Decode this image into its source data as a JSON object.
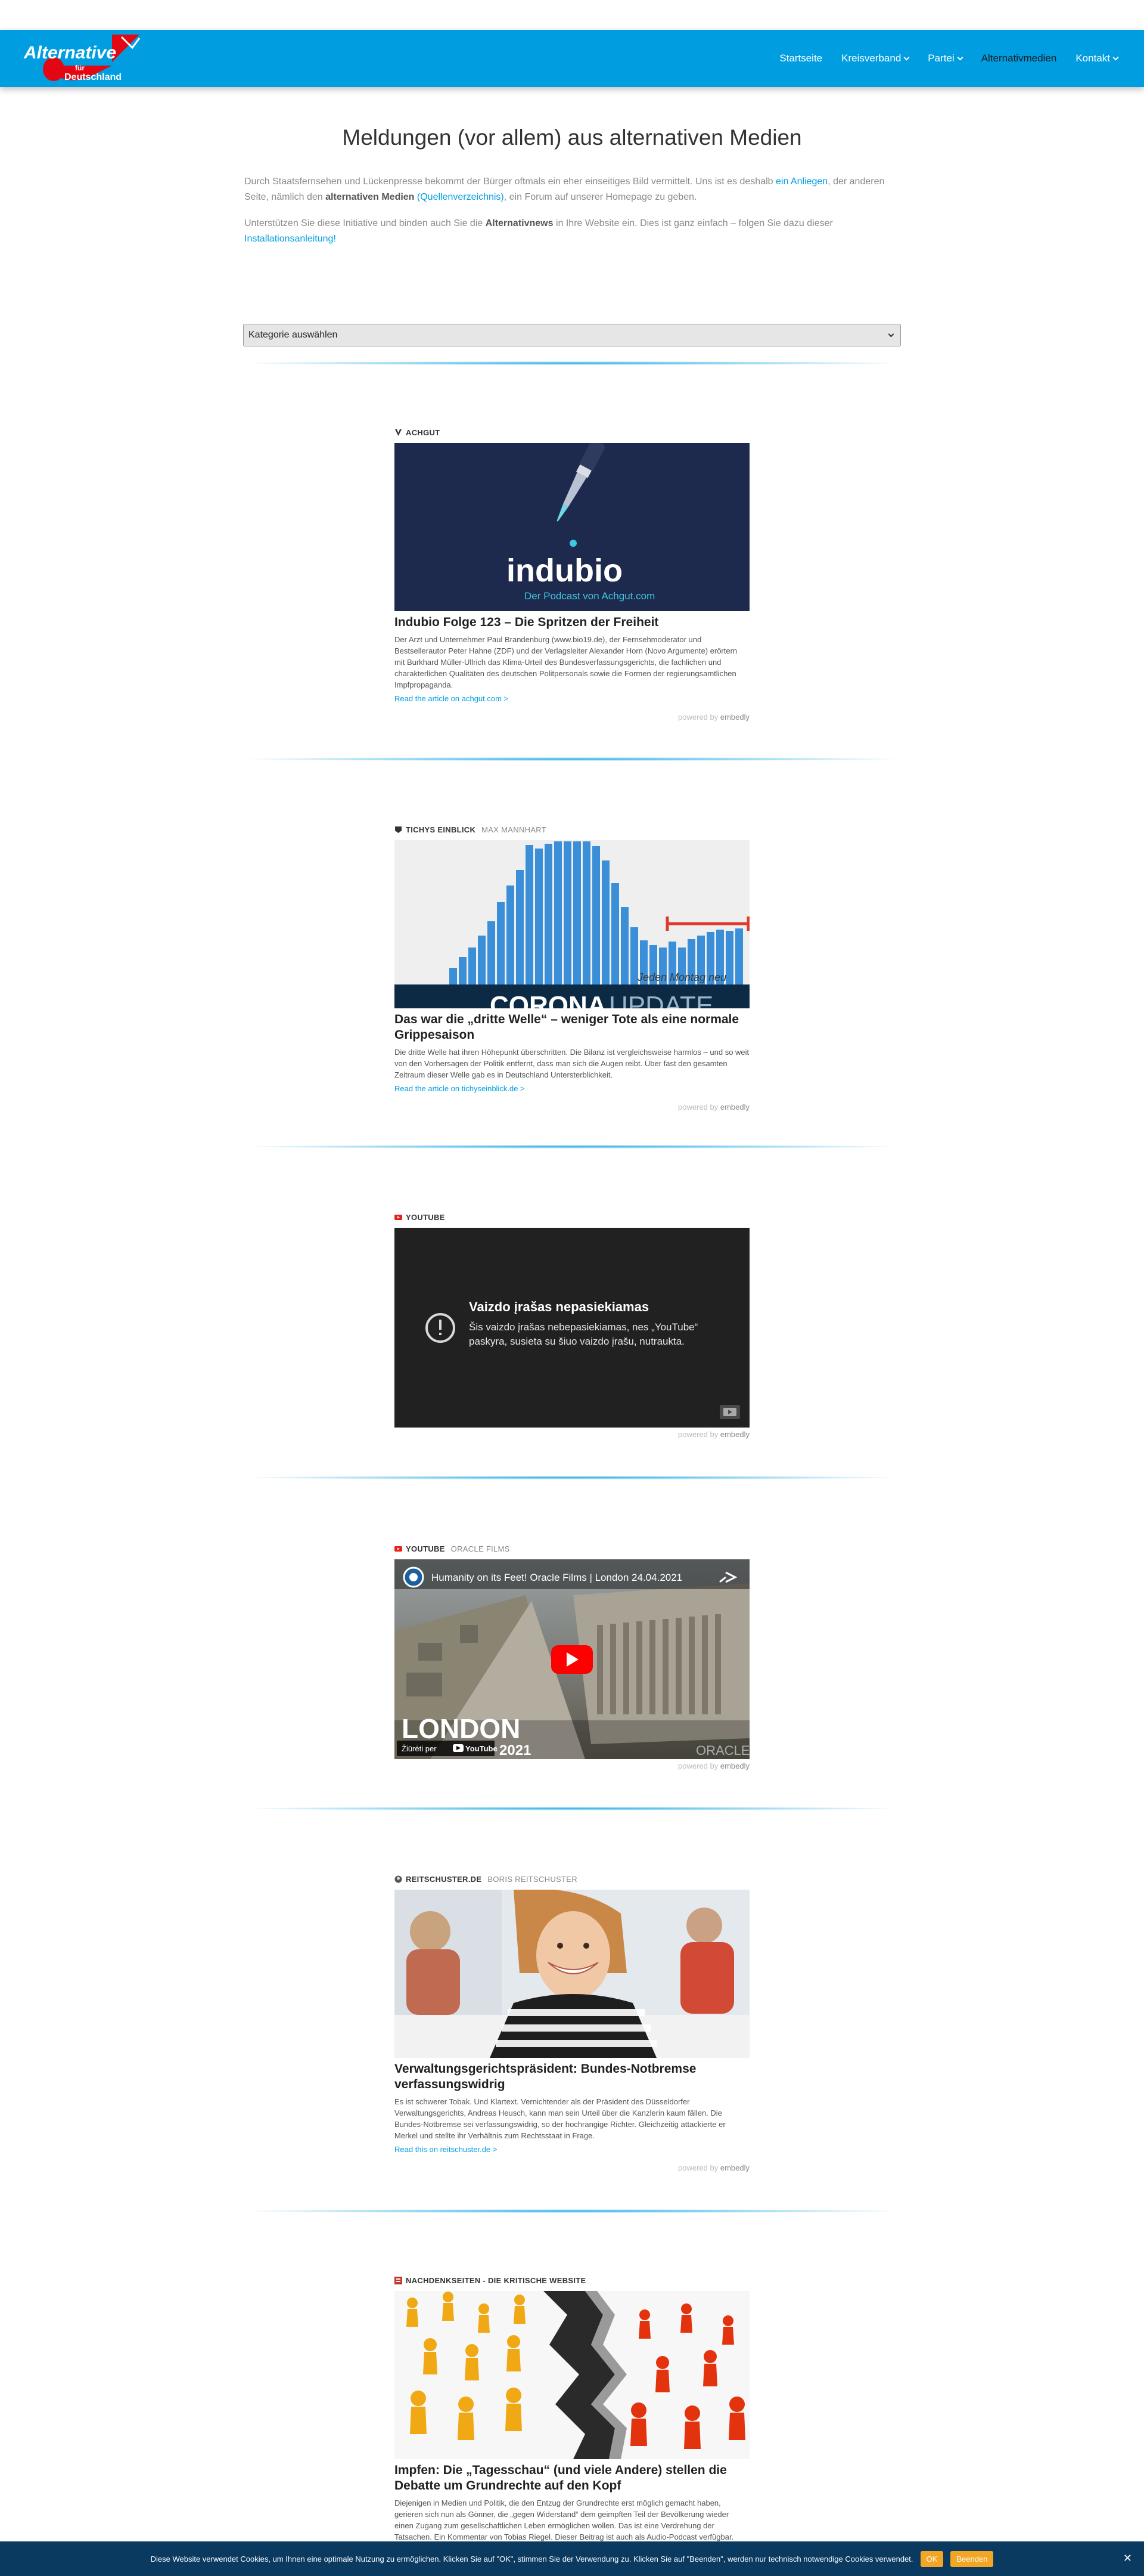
{
  "header": {
    "logo_text_1": "Alternative",
    "logo_text_2": "für",
    "logo_text_3": "Deutschland",
    "nav": [
      {
        "label": "Startseite"
      },
      {
        "label": "Kreisverband"
      },
      {
        "label": "Partei"
      },
      {
        "label": "Alternativmedien"
      },
      {
        "label": "Kontakt"
      }
    ],
    "accent_color": "#009ee0"
  },
  "main": {
    "title": "Meldungen (vor allem) aus alternativen Medien",
    "intro1_a": "Durch Staatsfernsehen und Lückenpresse bekommt der Bürger oftmals ein eher einseitiges Bild vermittelt. Uns ist es deshalb ",
    "intro1_link1": "ein Anliegen",
    "intro1_b": ", der anderen Seite, nämlich den ",
    "intro1_bold": "alternativen Medien",
    "intro1_c": " ",
    "intro1_link2": "(Quellenverzeichnis)",
    "intro1_d": ", ein Forum auf unserer Homepage zu geben.",
    "intro2_a": "Unterstützen Sie diese Initiative und binden auch Sie die ",
    "intro2_bold": "Alternativnews",
    "intro2_b": " in Ihre Website ein. Dies ist ganz einfach – folgen Sie dazu dieser ",
    "intro2_link": "Installationsanleitung!",
    "category_select": "Kategorie auswählen"
  },
  "embedly": {
    "powered": "powered by",
    "brand": "embedly"
  },
  "cards": [
    {
      "source": "ACHGUT",
      "author": "",
      "image_title": "indubio",
      "image_subtitle": "Der Podcast von Achgut.com",
      "title": "Indubio Folge 123 – Die Spritzen der Freiheit",
      "desc": "Der Arzt und Unternehmer Paul Brandenburg (www.bio19.de), der Fernsehmoderator und Bestsellerautor Peter Hahne (ZDF) und der Verlagsleiter Alexander Horn (Novo Argumente) erörtern mit Burkhard Müller-Ullrich das Klima-Urteil des Bundesverfassungsgerichts, die fachlichen und charakterlichen Qualitäten des deutschen Politpersonals sowie die Formen der regierungsamtlichen Impfpropaganda.",
      "link": "Read the article on achgut.com >"
    },
    {
      "source": "TICHYS EINBLICK",
      "author": "MAX MANNHART",
      "image_overlay": "Jeden Montag neu",
      "image_big": "CORONA",
      "image_big2": "UPDATE",
      "title": "Das war die „dritte Welle“ – weniger Tote als eine normale Grippesaison",
      "desc": "Die dritte Welle hat ihren Höhepunkt überschritten. Die Bilanz ist vergleichsweise harmlos – und so weit von den Vorhersagen der Politik entfernt, dass man sich die Augen reibt. Über fast den gesamten Zeitraum dieser Welle gab es in Deutschland Untersterblichkeit.",
      "link": "Read the article on tichyseinblick.de >"
    },
    {
      "source": "YOUTUBE",
      "author": "",
      "video_title": "Vaizdo įrašas nepasiekiamas",
      "video_msg_1": "Šis vaizdo įrašas nebepasiekiamas, nes „YouTube“",
      "video_msg_2": "paskyra, susieta su šiuo vaizdo įrašu, nutraukta."
    },
    {
      "source": "YOUTUBE",
      "author": "ORACLE FILMS",
      "video_title": "Humanity on its Feet! Oracle Films | London 24.04.2021",
      "big_text": "LONDON",
      "year": "2021",
      "watch_on": "Žiūrėti per",
      "yt_label": "YouTube",
      "watermark": "ORACLE"
    },
    {
      "source": "REITSCHUSTER.DE",
      "author": "BORIS REITSCHUSTER",
      "title": "Verwaltungsgerichtspräsident: Bundes-Notbremse verfassungswidrig",
      "desc": "Es ist schwerer Tobak. Und Klartext. Vernichtender als der Präsident des Düsseldorfer Verwaltungsgerichts, Andreas Heusch, kann man sein Urteil über die Kanzlerin kaum fällen. Die Bundes-Notbremse sei verfassungswidrig, so der hochrangige Richter. Gleichzeitig attackierte er Merkel und stellte ihr Verhältnis zum Rechtsstaat in Frage.",
      "link": "Read this on reitschuster.de >"
    },
    {
      "source": "NACHDENKSEITEN - DIE KRITISCHE WEBSITE",
      "author": "",
      "title": "Impfen: Die „Tagesschau“ (und viele Andere) stellen die Debatte um Grundrechte auf den Kopf",
      "desc": "Diejenigen in Medien und Politik, die den Entzug der Grundrechte erst möglich gemacht haben, gerieren sich nun als Gönner, die „gegen Widerstand“ dem geimpften Teil der Bevölkerung wieder einen Zugang zum gesellschaftlichen Leben ermöglichen wollen. Das ist eine Verdrehung der Tatsachen. Ein Kommentar von Tobias Riegel. Dieser Beitrag ist auch als Audio-Podcast verfügbar."
    }
  ],
  "cookie": {
    "text": "Diese Website verwendet Cookies, um Ihnen eine optimale Nutzung zu ermöglichen. Klicken Sie auf \"OK\", stimmen Sie der Verwendung zu. Klicken Sie auf \"Beenden\", werden nur technisch notwendige Cookies verwendet.",
    "ok": "OK",
    "end": "Beenden",
    "close": "✕"
  }
}
